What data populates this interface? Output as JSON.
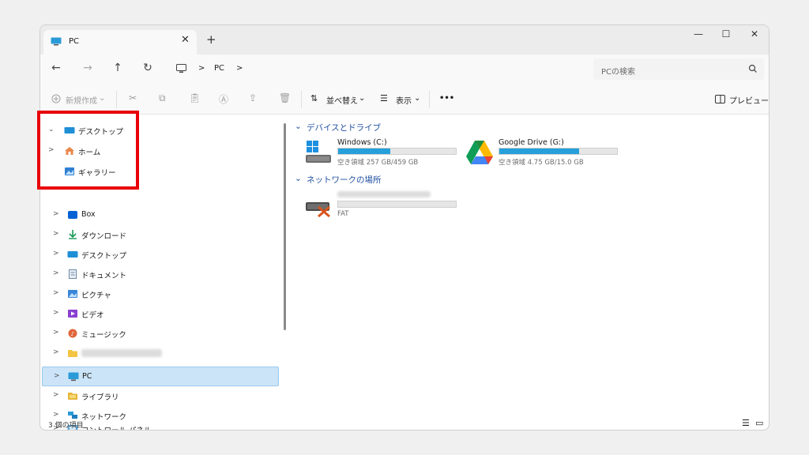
{
  "window": {
    "tab_title": "PC",
    "new_tab": "+",
    "controls": {
      "minimize": "—",
      "maximize": "☐",
      "close": "✕"
    }
  },
  "nav": {
    "back": "←",
    "forward": "→",
    "up": "↑",
    "refresh": "↻",
    "breadcrumb": [
      "PC"
    ],
    "crumb_sep": ">",
    "search_placeholder": "PCの検索"
  },
  "toolbar": {
    "new_label": "新規作成",
    "sort_label": "並べ替え",
    "view_label": "表示",
    "more_label": "•••",
    "preview_label": "プレビュー"
  },
  "sidebar": {
    "highlighted": [
      {
        "label": "デスクトップ",
        "icon": "desktop-icon",
        "chev": "⌄"
      },
      {
        "label": "ホーム",
        "icon": "home-icon",
        "chev": ">"
      },
      {
        "label": "ギャラリー",
        "icon": "gallery-icon",
        "chev": ""
      }
    ],
    "items": [
      {
        "label": "Box",
        "icon": "box-icon"
      },
      {
        "label": "ダウンロード",
        "icon": "download-icon"
      },
      {
        "label": "デスクトップ",
        "icon": "desktop-icon"
      },
      {
        "label": "ドキュメント",
        "icon": "document-icon"
      },
      {
        "label": "ピクチャ",
        "icon": "pictures-icon"
      },
      {
        "label": "ビデオ",
        "icon": "video-icon"
      },
      {
        "label": "ミュージック",
        "icon": "music-icon"
      },
      {
        "label": "",
        "icon": "folder-icon"
      },
      {
        "label": "PC",
        "icon": "pc-icon",
        "selected": true
      },
      {
        "label": "ライブラリ",
        "icon": "library-icon"
      },
      {
        "label": "ネットワーク",
        "icon": "network-icon"
      },
      {
        "label": "コントロール パネル",
        "icon": "control-panel-icon"
      }
    ]
  },
  "content": {
    "groups": [
      {
        "title": "デバイスとドライブ"
      },
      {
        "title": "ネットワークの場所"
      }
    ],
    "drives": [
      {
        "name": "Windows (C:)",
        "sub": "空き領域 257 GB/459 GB",
        "used_fraction": 0.44,
        "icon": "windows-drive-icon"
      },
      {
        "name": "Google Drive (G:)",
        "sub": "空き領域 4.75 GB/15.0 GB",
        "used_fraction": 0.68,
        "icon": "google-drive-icon"
      },
      {
        "name": "",
        "sub": "FAT",
        "used_fraction": 0,
        "icon": "network-drive-disconnected-icon"
      }
    ]
  },
  "status": {
    "count": "3 個の項目"
  },
  "colors": {
    "accent": "#26a0da",
    "selection": "#cce4f7",
    "highlight_box": "#e8000a",
    "group_title": "#1f4fa0"
  }
}
